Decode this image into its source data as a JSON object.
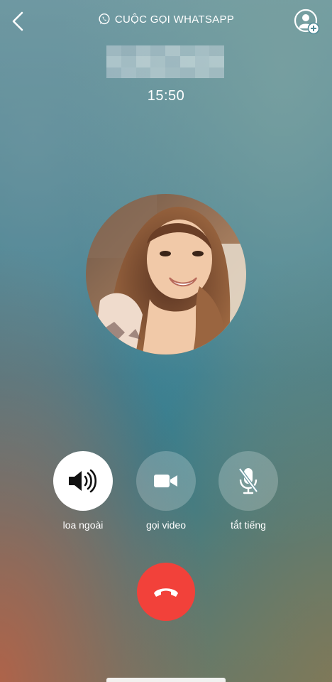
{
  "header": {
    "title": "CUỘC GỌI WHATSAPP",
    "back_icon": "chevron-left-icon",
    "brand_icon": "whatsapp-icon",
    "add_participant_icon": "add-person-icon"
  },
  "call": {
    "caller_name": "",
    "duration": "15:50",
    "avatar": "caller-photo"
  },
  "controls": [
    {
      "label": "loa ngoài",
      "icon": "speaker-icon",
      "active": true
    },
    {
      "label": "gọi video",
      "icon": "video-camera-icon",
      "active": false
    },
    {
      "label": "tắt tiếng",
      "icon": "microphone-muted-icon",
      "active": false
    }
  ],
  "end_call": {
    "icon": "hang-up-icon",
    "color": "#f2413a"
  },
  "colors": {
    "text": "#ffffff",
    "end_call": "#f2413a"
  }
}
